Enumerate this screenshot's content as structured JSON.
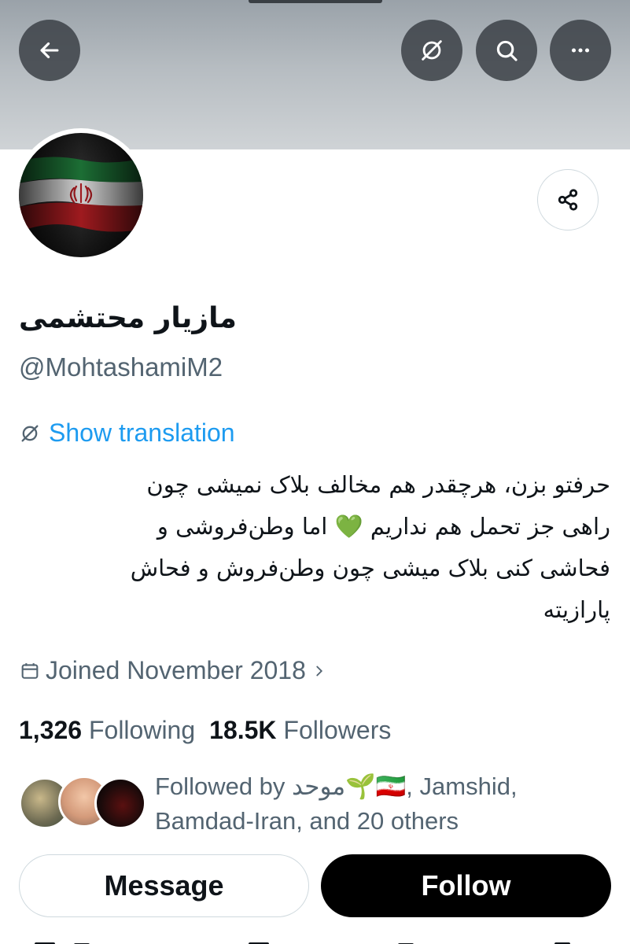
{
  "header": {
    "back_icon": "arrow-left-icon",
    "translate_icon": "globe-slash-icon",
    "search_icon": "search-icon",
    "more_icon": "more-horizontal-icon"
  },
  "profile": {
    "display_name": "مازیار محتشمی",
    "handle": "@MohtashamiM2",
    "show_translation": "Show translation",
    "bio_lines": [
      "حرفتو بزن، هرچقدر هم مخالف بلاک نمیشی چون",
      "راهی جز تحمل هم نداریم 💚 اما وطن‌فروشی و",
      "فحاشی کنی بلاک میشی چون وطن‌فروش و فحاش",
      "پارازیته"
    ],
    "joined": "Joined November 2018",
    "following_count": "1,326",
    "following_label": "Following",
    "followers_count": "18.5K",
    "followers_label": "Followers",
    "followed_by_line1": "Followed by موحد🌱🇮🇷, Jamshid,",
    "followed_by_line2": "Bamdad-Iran, and 20 others"
  },
  "actions": {
    "message_label": "Message",
    "follow_label": "Follow"
  },
  "colors": {
    "link": "#1d9bf0",
    "secondary_text": "#536471",
    "primary_text": "#0f1419",
    "flag_green": "#239f40",
    "flag_red": "#da0000"
  }
}
